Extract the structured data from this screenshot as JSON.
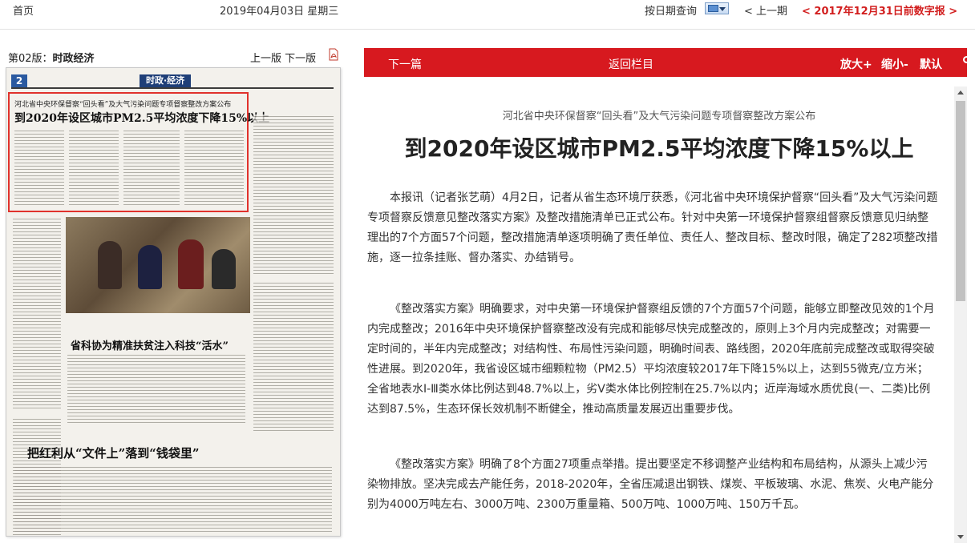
{
  "topbar": {
    "home": "首页",
    "date": "2019年04月03日  星期三",
    "by_date": "按日期查询",
    "prev_issue": "< 上一期",
    "latest": "< 2017年12月31日前数字报 >"
  },
  "page": {
    "label_prefix": "第02版：",
    "label_section": "时政经济",
    "prev_page": "上一版",
    "next_page": "下一版"
  },
  "thumbnail": {
    "page_number": "2",
    "section": "时政·经济",
    "headline_sub": "河北省中央环保督察“回头看”及大气污染问题专项督察整改方案公布",
    "headline_main": "到2020年设区城市PM2.5平均浓度下降15%以上",
    "headline_2": "省科协为精准扶贫注入科技“活水”",
    "headline_3": "把红利从“文件上”落到“钱袋里”"
  },
  "toolbar": {
    "next_article": "下一篇",
    "back_column": "返回栏目",
    "zoom_in": "放大+",
    "zoom_out": "缩小-",
    "default": "默认"
  },
  "article": {
    "subtitle": "河北省中央环保督察“回头看”及大气污染问题专项督察整改方案公布",
    "title": "到2020年设区城市PM2.5平均浓度下降15%以上",
    "paragraphs": [
      "本报讯（记者张艺萌）4月2日，记者从省生态环境厅获悉，《河北省中央环境保护督察“回头看”及大气污染问题专项督察反馈意见整改落实方案》及整改措施清单已正式公布。针对中央第一环境保护督察组督察反馈意见归纳整理出的7个方面57个问题，整改措施清单逐项明确了责任单位、责任人、整改目标、整改时限，确定了282项整改措施，逐一拉条挂账、督办落实、办结销号。",
      "《整改落实方案》明确要求，对中央第一环境保护督察组反馈的7个方面57个问题，能够立即整改见效的1个月内完成整改；2016年中央环境保护督察整改没有完成和能够尽快完成整改的，原则上3个月内完成整改；对需要一定时间的，半年内完成整改；对结构性、布局性污染问题，明确时间表、路线图，2020年底前完成整改或取得突破性进展。到2020年，我省设区城市细颗粒物（PM2.5）平均浓度较2017年下降15%以上，达到55微克/立方米；全省地表水Ⅰ-Ⅲ类水体比例达到48.7%以上，劣Ⅴ类水体比例控制在25.7%以内；近岸海域水质优良(一、二类)比例达到87.5%，生态环保长效机制不断健全，推动高质量发展迈出重要步伐。",
      "《整改落实方案》明确了8个方面27项重点举措。提出要坚定不移调整产业结构和布局结构，从源头上减少污染物排放。坚决完成去产能任务，2018-2020年，全省压减退出钢铁、煤炭、平板玻璃、水泥、焦炭、火电产能分别为4000万吨左右、3000万吨、2300万重量箱、500万吨、1000万吨、150万千瓦。"
    ]
  },
  "colors": {
    "toolbar_red": "#d7191f",
    "latest_link": "#d21e1e",
    "highlight_box": "#e0322c"
  }
}
